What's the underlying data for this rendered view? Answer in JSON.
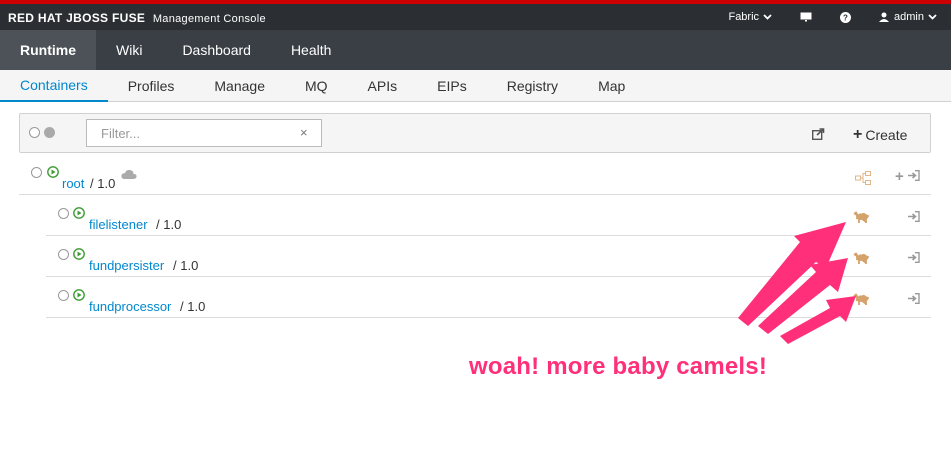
{
  "brand": {
    "name": "RED HAT JBOSS FUSE",
    "subtitle": "Management Console"
  },
  "topbar": {
    "fabric_label": "Fabric",
    "user_label": "admin"
  },
  "main_nav": [
    {
      "label": "Runtime",
      "active": true
    },
    {
      "label": "Wiki"
    },
    {
      "label": "Dashboard"
    },
    {
      "label": "Health"
    }
  ],
  "sub_nav": [
    {
      "label": "Containers",
      "active": true
    },
    {
      "label": "Profiles"
    },
    {
      "label": "Manage"
    },
    {
      "label": "MQ"
    },
    {
      "label": "APIs"
    },
    {
      "label": "EIPs"
    },
    {
      "label": "Registry"
    },
    {
      "label": "Map"
    }
  ],
  "toolbar": {
    "filter_placeholder": "Filter...",
    "clear_icon": "×",
    "create_label": "Create"
  },
  "containers": [
    {
      "name": "root",
      "version": "1.0"
    },
    {
      "name": "filelistener",
      "version": "1.0"
    },
    {
      "name": "fundpersister",
      "version": "1.0"
    },
    {
      "name": "fundprocessor",
      "version": "1.0"
    }
  ],
  "version_separator": "/",
  "annotation": {
    "text": "woah! more baby camels!",
    "color": "#ff2f7a"
  },
  "colors": {
    "brand_red": "#cc0000",
    "link_blue": "#0088ce",
    "status_green": "#3f9c35",
    "camel_tan": "#d4a26b"
  }
}
